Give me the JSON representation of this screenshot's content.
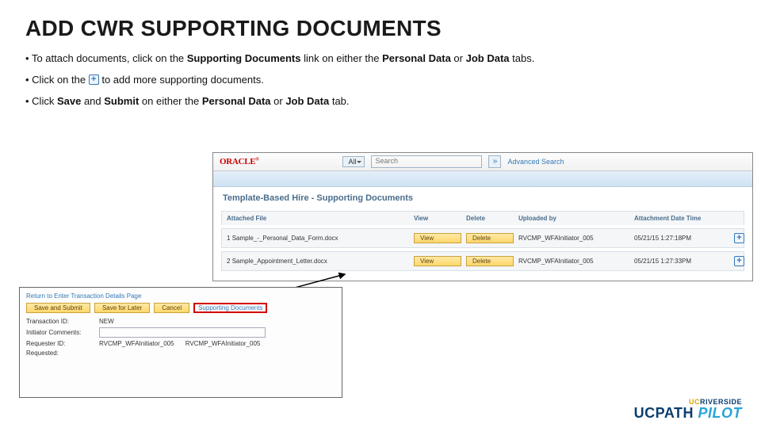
{
  "title": "ADD CWR SUPPORTING DOCUMENTS",
  "bullets": {
    "b1a": "To attach documents, click on the ",
    "b1b": "Supporting Documents",
    "b1c": " link on either the ",
    "b1d": "Personal Data",
    "b1e": " or ",
    "b1f": "Job Data",
    "b1g": " tabs.",
    "b2a": "Click on the ",
    "b2b": " to add more supporting documents.",
    "b3a": "Click ",
    "b3b": "Save",
    "b3c": " and ",
    "b3d": "Submit",
    "b3e": " on either the ",
    "b3f": "Personal Data",
    "b3g": " or ",
    "b3h": "Job Data",
    "b3i": " tab."
  },
  "app": {
    "brand": "ORACLE",
    "allLabel": "All",
    "searchPlaceholder": "Search",
    "advanced": "Advanced Search",
    "pageTitle": "Template-Based Hire - Supporting Documents",
    "headers": {
      "file": "Attached File",
      "view": "View",
      "delete": "Delete",
      "uploader": "Uploaded by",
      "dt": "Attachment Date Time"
    },
    "rows": [
      {
        "idx": "1",
        "file": "Sample_-_Personal_Data_Form.docx",
        "view": "View",
        "del": "Delete",
        "by": "RVCMP_WFAInitiator_005",
        "dt": "05/21/15  1:27:18PM"
      },
      {
        "idx": "2",
        "file": "Sample_Appointment_Letter.docx",
        "view": "View",
        "del": "Delete",
        "by": "RVCMP_WFAInitiator_005",
        "dt": "05/21/15  1:27:33PM"
      }
    ]
  },
  "form": {
    "back": "Return to Enter Transaction Details Page",
    "saveSubmit": "Save and Submit",
    "saveLater": "Save for Later",
    "cancel": "Cancel",
    "supporting": "Supporting Documents",
    "transIdLabel": "Transaction ID:",
    "transIdVal": "NEW",
    "commentsLabel": "Initiator Comments:",
    "reqIdLabel": "Requester ID:",
    "reqIdVal1": "RVCMP_WFAInitiator_005",
    "reqIdVal2": "RVCMP_WFAInitiator_005",
    "requestedLabel": "Requested:"
  },
  "footer": {
    "uc": "UC",
    "riverside": "RIVERSIDE",
    "ucpath": "UCPATH",
    "pilot": " PILOT"
  }
}
